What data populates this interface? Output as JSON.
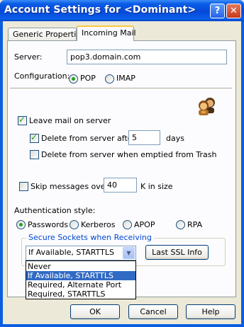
{
  "window": {
    "title": "Account Settings for <Dominant>",
    "help_glyph": "?",
    "close_glyph": "✕"
  },
  "tabs": [
    {
      "label": "Generic Properties"
    },
    {
      "label": "Incoming Mail"
    }
  ],
  "server": {
    "label": "Server:",
    "value": "pop3.domain.com"
  },
  "configuration": {
    "label": "Configuration:",
    "options": [
      {
        "label": "POP",
        "selected": true
      },
      {
        "label": "IMAP",
        "selected": false
      }
    ]
  },
  "leave_mail": {
    "label": "Leave mail on server",
    "checked": true,
    "delete_after": {
      "prefix": "Delete from server after",
      "value": "5",
      "suffix": "days",
      "checked": true
    },
    "delete_trash": {
      "label": "Delete from server when emptied from Trash",
      "checked": false
    }
  },
  "skip": {
    "prefix": "Skip messages over",
    "value": "40",
    "suffix": "K in size",
    "checked": false
  },
  "auth": {
    "label": "Authentication style:",
    "options": [
      {
        "label": "Passwords",
        "selected": true
      },
      {
        "label": "Kerberos",
        "selected": false
      },
      {
        "label": "APOP",
        "selected": false
      },
      {
        "label": "RPA",
        "selected": false
      }
    ]
  },
  "ssl": {
    "group_title": "Secure Sockets when Receiving",
    "selected": "If Available, STARTTLS",
    "options": [
      "Never",
      "If Available, STARTTLS",
      "Required, Alternate Port",
      "Required, STARTTLS"
    ],
    "highlighted_index": 1,
    "last_ssl_button": "Last SSL Info"
  },
  "buttons": {
    "ok": "OK",
    "cancel": "Cancel",
    "help": "Help"
  }
}
